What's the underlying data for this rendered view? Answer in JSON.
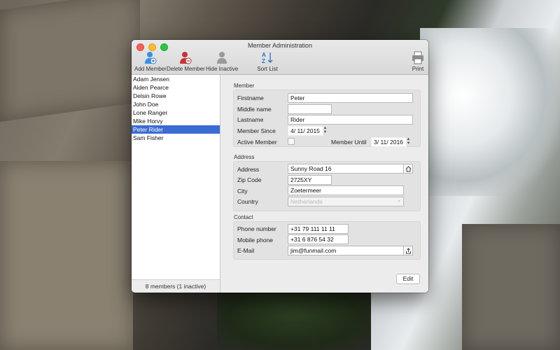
{
  "window": {
    "title": "Member Administration"
  },
  "toolbar": {
    "add_member": "Add Member",
    "delete_member": "Delete Member",
    "hide_inactive": "Hide Inactive",
    "sort_list": "Sort List",
    "print": "Print"
  },
  "members": {
    "items": [
      "Adam Jensen",
      "Aiden Pearce",
      "Delsin Rowe",
      "John Doe",
      "Lone Ranger",
      "Mike Horvy",
      "Peter Rider",
      "Sam Fisher"
    ],
    "selected": "Peter Rider",
    "footer": "8 members (1 inactive)"
  },
  "member_section": {
    "title": "Member",
    "firstname_label": "Firstname",
    "firstname": "Peter",
    "middlename_label": "Middle name",
    "middlename": "",
    "lastname_label": "Lastname",
    "lastname": "Rider",
    "member_since_label": "Member Since",
    "member_since": "4/ 11/ 2015",
    "active_label": "Active Member",
    "active": false,
    "member_until_label": "Member Until",
    "member_until": "3/ 11/ 2016"
  },
  "address_section": {
    "title": "Address",
    "address_label": "Address",
    "address": "Sunny Road 16",
    "zip_label": "Zip Code",
    "zip": "2725XY",
    "city_label": "City",
    "city": "Zoetermeer",
    "country_label": "Country",
    "country": "Netherlands"
  },
  "contact_section": {
    "title": "Contact",
    "phone_label": "Phone number",
    "phone": "+31 79 111 11 11",
    "mobile_label": "Mobile phone",
    "mobile": "+31 6 876 54 32",
    "email_label": "E-Mail",
    "email": "jim@funmail.com"
  },
  "actions": {
    "edit": "Edit"
  },
  "colors": {
    "selection": "#3b6cd2",
    "add_icon": "#3a8fe0",
    "delete_icon": "#c9333a"
  }
}
